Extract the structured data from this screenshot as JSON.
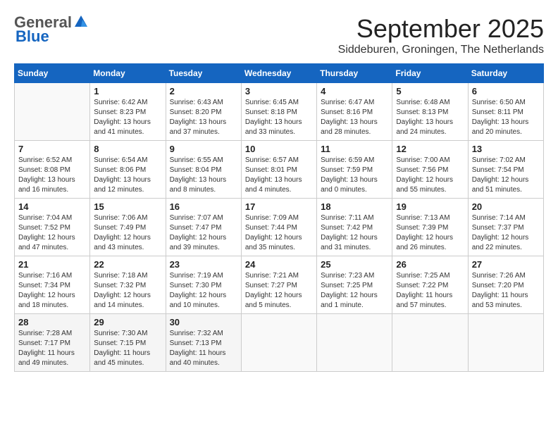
{
  "header": {
    "logo_general": "General",
    "logo_blue": "Blue",
    "month_year": "September 2025",
    "location": "Siddeburen, Groningen, The Netherlands"
  },
  "weekdays": [
    "Sunday",
    "Monday",
    "Tuesday",
    "Wednesday",
    "Thursday",
    "Friday",
    "Saturday"
  ],
  "weeks": [
    [
      {
        "day": "",
        "info": ""
      },
      {
        "day": "1",
        "info": "Sunrise: 6:42 AM\nSunset: 8:23 PM\nDaylight: 13 hours\nand 41 minutes."
      },
      {
        "day": "2",
        "info": "Sunrise: 6:43 AM\nSunset: 8:20 PM\nDaylight: 13 hours\nand 37 minutes."
      },
      {
        "day": "3",
        "info": "Sunrise: 6:45 AM\nSunset: 8:18 PM\nDaylight: 13 hours\nand 33 minutes."
      },
      {
        "day": "4",
        "info": "Sunrise: 6:47 AM\nSunset: 8:16 PM\nDaylight: 13 hours\nand 28 minutes."
      },
      {
        "day": "5",
        "info": "Sunrise: 6:48 AM\nSunset: 8:13 PM\nDaylight: 13 hours\nand 24 minutes."
      },
      {
        "day": "6",
        "info": "Sunrise: 6:50 AM\nSunset: 8:11 PM\nDaylight: 13 hours\nand 20 minutes."
      }
    ],
    [
      {
        "day": "7",
        "info": "Sunrise: 6:52 AM\nSunset: 8:08 PM\nDaylight: 13 hours\nand 16 minutes."
      },
      {
        "day": "8",
        "info": "Sunrise: 6:54 AM\nSunset: 8:06 PM\nDaylight: 13 hours\nand 12 minutes."
      },
      {
        "day": "9",
        "info": "Sunrise: 6:55 AM\nSunset: 8:04 PM\nDaylight: 13 hours\nand 8 minutes."
      },
      {
        "day": "10",
        "info": "Sunrise: 6:57 AM\nSunset: 8:01 PM\nDaylight: 13 hours\nand 4 minutes."
      },
      {
        "day": "11",
        "info": "Sunrise: 6:59 AM\nSunset: 7:59 PM\nDaylight: 13 hours\nand 0 minutes."
      },
      {
        "day": "12",
        "info": "Sunrise: 7:00 AM\nSunset: 7:56 PM\nDaylight: 12 hours\nand 55 minutes."
      },
      {
        "day": "13",
        "info": "Sunrise: 7:02 AM\nSunset: 7:54 PM\nDaylight: 12 hours\nand 51 minutes."
      }
    ],
    [
      {
        "day": "14",
        "info": "Sunrise: 7:04 AM\nSunset: 7:52 PM\nDaylight: 12 hours\nand 47 minutes."
      },
      {
        "day": "15",
        "info": "Sunrise: 7:06 AM\nSunset: 7:49 PM\nDaylight: 12 hours\nand 43 minutes."
      },
      {
        "day": "16",
        "info": "Sunrise: 7:07 AM\nSunset: 7:47 PM\nDaylight: 12 hours\nand 39 minutes."
      },
      {
        "day": "17",
        "info": "Sunrise: 7:09 AM\nSunset: 7:44 PM\nDaylight: 12 hours\nand 35 minutes."
      },
      {
        "day": "18",
        "info": "Sunrise: 7:11 AM\nSunset: 7:42 PM\nDaylight: 12 hours\nand 31 minutes."
      },
      {
        "day": "19",
        "info": "Sunrise: 7:13 AM\nSunset: 7:39 PM\nDaylight: 12 hours\nand 26 minutes."
      },
      {
        "day": "20",
        "info": "Sunrise: 7:14 AM\nSunset: 7:37 PM\nDaylight: 12 hours\nand 22 minutes."
      }
    ],
    [
      {
        "day": "21",
        "info": "Sunrise: 7:16 AM\nSunset: 7:34 PM\nDaylight: 12 hours\nand 18 minutes."
      },
      {
        "day": "22",
        "info": "Sunrise: 7:18 AM\nSunset: 7:32 PM\nDaylight: 12 hours\nand 14 minutes."
      },
      {
        "day": "23",
        "info": "Sunrise: 7:19 AM\nSunset: 7:30 PM\nDaylight: 12 hours\nand 10 minutes."
      },
      {
        "day": "24",
        "info": "Sunrise: 7:21 AM\nSunset: 7:27 PM\nDaylight: 12 hours\nand 5 minutes."
      },
      {
        "day": "25",
        "info": "Sunrise: 7:23 AM\nSunset: 7:25 PM\nDaylight: 12 hours\nand 1 minute."
      },
      {
        "day": "26",
        "info": "Sunrise: 7:25 AM\nSunset: 7:22 PM\nDaylight: 11 hours\nand 57 minutes."
      },
      {
        "day": "27",
        "info": "Sunrise: 7:26 AM\nSunset: 7:20 PM\nDaylight: 11 hours\nand 53 minutes."
      }
    ],
    [
      {
        "day": "28",
        "info": "Sunrise: 7:28 AM\nSunset: 7:17 PM\nDaylight: 11 hours\nand 49 minutes."
      },
      {
        "day": "29",
        "info": "Sunrise: 7:30 AM\nSunset: 7:15 PM\nDaylight: 11 hours\nand 45 minutes."
      },
      {
        "day": "30",
        "info": "Sunrise: 7:32 AM\nSunset: 7:13 PM\nDaylight: 11 hours\nand 40 minutes."
      },
      {
        "day": "",
        "info": ""
      },
      {
        "day": "",
        "info": ""
      },
      {
        "day": "",
        "info": ""
      },
      {
        "day": "",
        "info": ""
      }
    ]
  ]
}
